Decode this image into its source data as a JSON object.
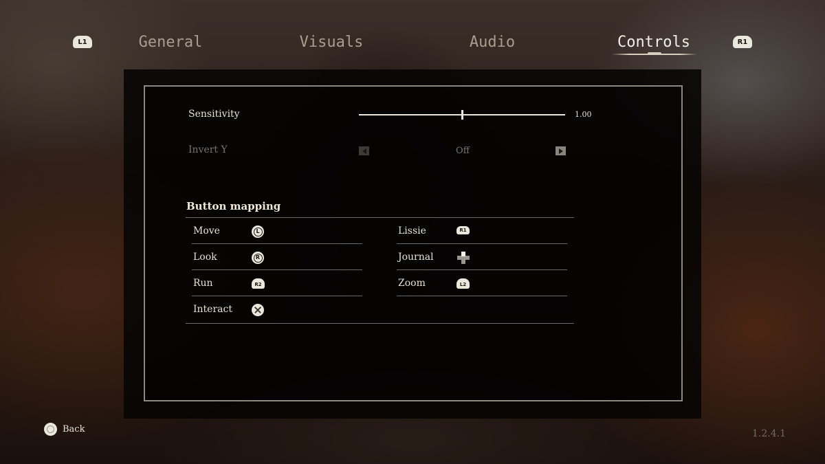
{
  "tabs": {
    "left_shoulder": "L1",
    "right_shoulder": "R1",
    "items": [
      {
        "label": "General"
      },
      {
        "label": "Visuals"
      },
      {
        "label": "Audio"
      },
      {
        "label": "Controls"
      }
    ],
    "active": "Controls"
  },
  "settings": {
    "sensitivity": {
      "label": "Sensitivity",
      "value_text": "1.00",
      "slider_fraction": 0.5
    },
    "invert_y": {
      "label": "Invert Y",
      "value": "Off"
    }
  },
  "button_mapping": {
    "title": "Button mapping",
    "left_column": [
      {
        "action": "Move",
        "glyph": "L",
        "icon": "left-stick-icon"
      },
      {
        "action": "Look",
        "glyph": "R",
        "icon": "right-stick-icon"
      },
      {
        "action": "Run",
        "glyph": "R2",
        "icon": "r2-trigger-icon"
      },
      {
        "action": "Interact",
        "glyph": "",
        "icon": "cross-button-icon"
      }
    ],
    "right_column": [
      {
        "action": "Lissie",
        "glyph": "R1",
        "icon": "r1-bumper-icon"
      },
      {
        "action": "Journal",
        "glyph": "",
        "icon": "dpad-up-icon"
      },
      {
        "action": "Zoom",
        "glyph": "L2",
        "icon": "l2-trigger-icon"
      }
    ]
  },
  "footer": {
    "back_label": "Back",
    "back_icon": "circle-button-icon",
    "version": "1.2.4.1"
  },
  "colors": {
    "text": "#e8e2d4",
    "muted": "#7a756b",
    "inactive_tab": "#a79f8e",
    "panel": "#060403"
  }
}
